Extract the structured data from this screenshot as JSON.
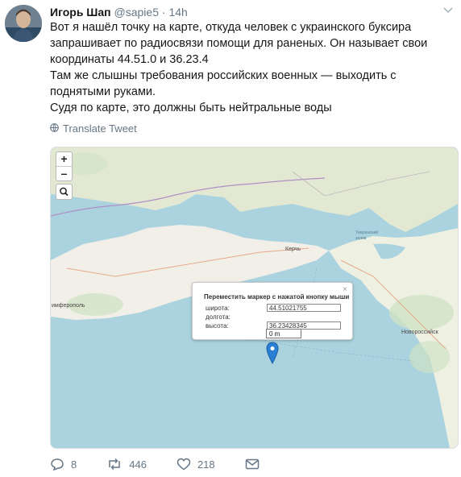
{
  "tweet": {
    "author_name": "Игорь Шап",
    "author_handle": "@sapie5",
    "separator": "·",
    "time": "14h",
    "text_lines": [
      "Вот я нашёл точку на карте, откуда человек с украинского буксира запрашивает по радиосвязи помощи для раненых. Он называет свои координаты 44.51.0 и 36.23.4",
      "Там же слышны требования российских военных — выходить с поднятыми руками.",
      "Судя по карте, это должны быть нейтральные воды"
    ],
    "translate_label": "Translate Tweet"
  },
  "map": {
    "zoom_in": "+",
    "zoom_out": "–",
    "places": {
      "simferopol": "имферополь",
      "kerch": "Керчь",
      "novorossiysk": "Новороссийск",
      "temryuk": "Темрюкский залив"
    },
    "popup": {
      "title": "Переместить маркер с нажатой кнопку мыши",
      "lat_label": "широта:",
      "lat_value": "44.51021755",
      "lon_label": "долгота:",
      "alt_label": "высота:",
      "alt_value": "36.23428345",
      "close": "×",
      "suggestion": "0 m"
    }
  },
  "actions": {
    "reply_count": "8",
    "retweet_count": "446",
    "like_count": "218"
  },
  "icons": [
    "caret-down-icon",
    "globe-icon",
    "search-icon",
    "map-marker-icon",
    "reply-icon",
    "retweet-icon",
    "like-icon",
    "message-icon"
  ],
  "colors": {
    "water": "#aad3df",
    "land": "#f2efe9",
    "text_secondary": "#657786",
    "marker": "#2a7fd4"
  }
}
